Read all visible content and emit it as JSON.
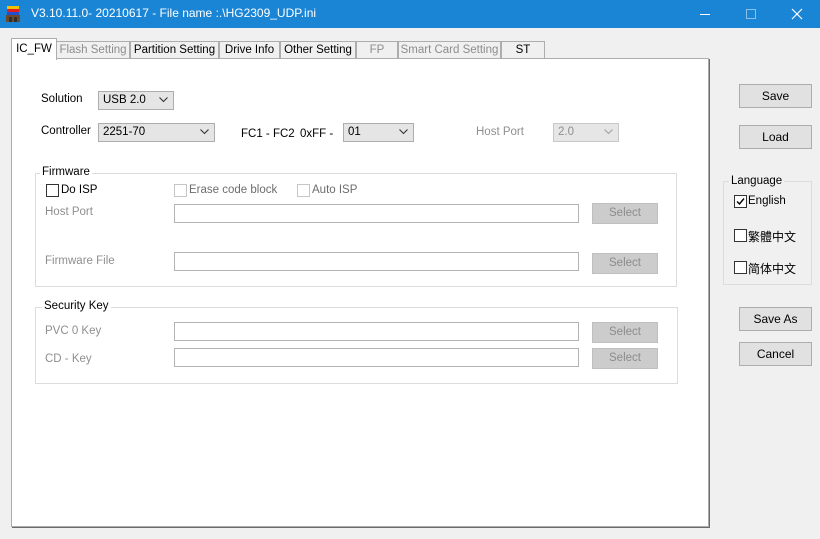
{
  "window": {
    "title": "V3.10.11.0- 20210617 - File name :.\\HG2309_UDP.ini",
    "app_icon": "app-logo-icon",
    "controls": [
      "minimize-icon",
      "maximize-icon",
      "close-icon"
    ]
  },
  "tabs": [
    {
      "label": "IC_FW",
      "state": "active"
    },
    {
      "label": "Flash Setting",
      "state": "disabled"
    },
    {
      "label": "Partition Setting",
      "state": "enabled"
    },
    {
      "label": "Drive Info",
      "state": "enabled"
    },
    {
      "label": "Other Setting",
      "state": "enabled"
    },
    {
      "label": "FP",
      "state": "disabled"
    },
    {
      "label": "Smart Card Setting",
      "state": "disabled"
    },
    {
      "label": "ST",
      "state": "enabled"
    }
  ],
  "ic_fw": {
    "solution": {
      "label": "Solution",
      "value": "USB 2.0"
    },
    "controller": {
      "label": "Controller",
      "value": "2251-70"
    },
    "fc": {
      "label": "FC1 - FC2",
      "prefix": "0xFF -",
      "value": "01"
    },
    "host_port": {
      "label": "Host Port",
      "value": "2.0"
    },
    "firmware": {
      "title": "Firmware",
      "do_isp": {
        "label": "Do ISP",
        "checked": false
      },
      "erase_code_block": {
        "label": "Erase code block",
        "checked": false
      },
      "auto_isp": {
        "label": "Auto ISP",
        "checked": false
      },
      "host_port_label": "Host Port",
      "host_port_value": "",
      "firmware_file_label": "Firmware File",
      "firmware_file_value": "",
      "select_label": "Select"
    },
    "security": {
      "title": "Security Key",
      "pvc0_label": "PVC 0 Key",
      "pvc0_value": "",
      "cd_label": "CD - Key",
      "cd_value": "",
      "select_label": "Select"
    }
  },
  "side": {
    "save": "Save",
    "load": "Load",
    "language": {
      "title": "Language",
      "options": [
        {
          "label": "English",
          "checked": true
        },
        {
          "label": "繁體中文",
          "checked": false
        },
        {
          "label": "简体中文",
          "checked": false
        }
      ]
    },
    "save_as": "Save As",
    "cancel": "Cancel"
  },
  "colors": {
    "titlebar": "#1b85d5",
    "window_bg": "#f0f0f0",
    "tab_page_bg": "#ffffff",
    "disabled_text": "#8f8f8f"
  }
}
